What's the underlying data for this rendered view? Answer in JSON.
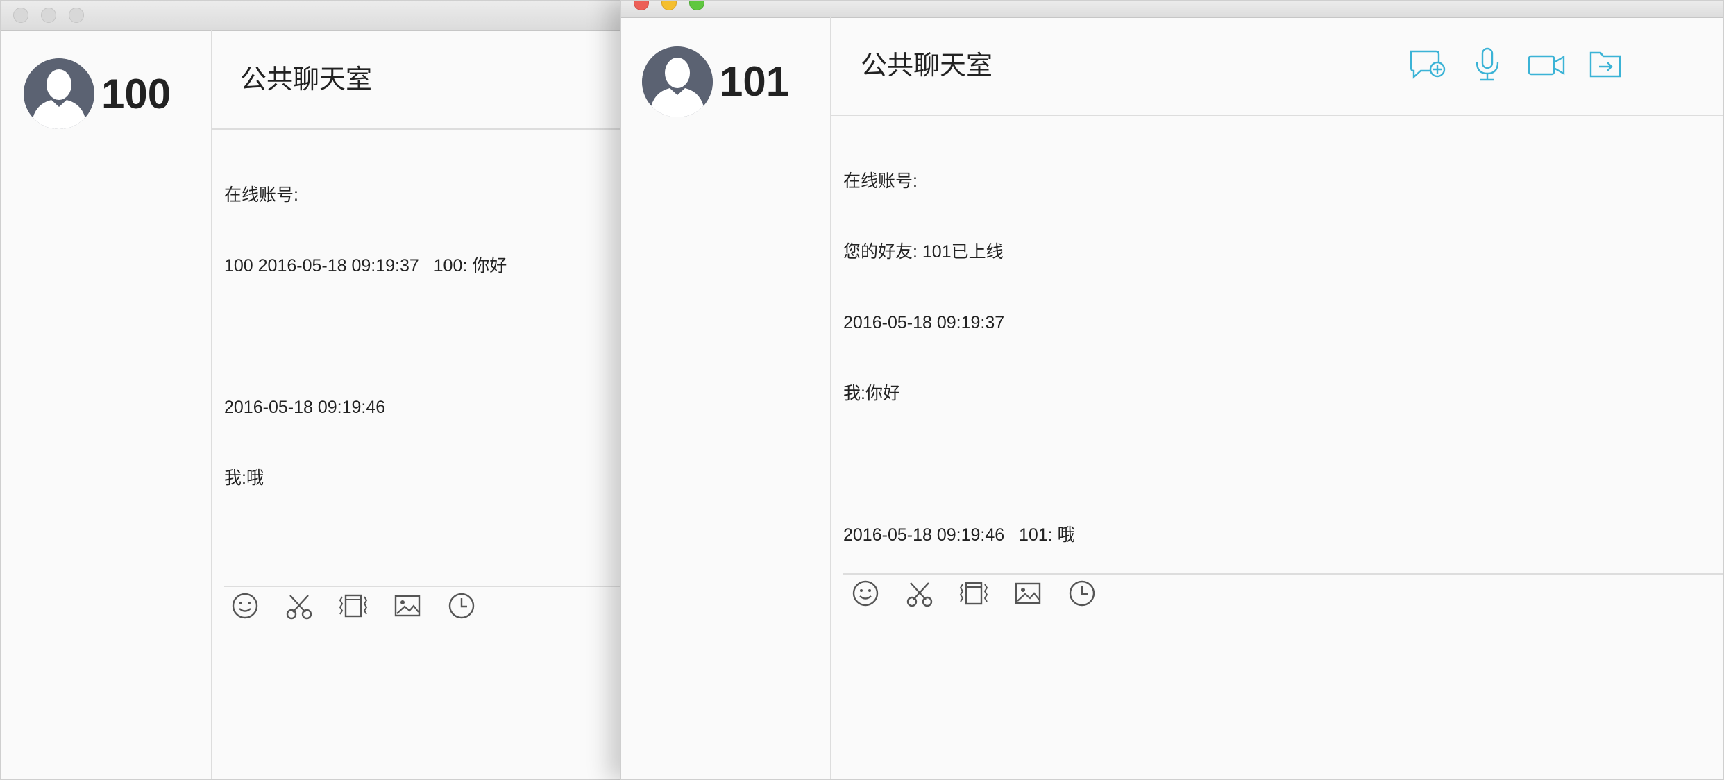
{
  "left_window": {
    "user_id": "100",
    "room_title": "公共聊天室",
    "messages": [
      "在线账号:",
      "100 2016-05-18 09:19:37   100: 你好",
      "",
      "2016-05-18 09:19:46",
      "我:哦"
    ]
  },
  "right_window": {
    "user_id": "101",
    "room_title": "公共聊天室",
    "messages": [
      "在线账号:",
      "您的好友: 101已上线",
      "2016-05-18 09:19:37",
      "我:你好",
      "",
      "2016-05-18 09:19:46   101: 哦"
    ],
    "actions": [
      "add-chat-icon",
      "microphone-icon",
      "video-camera-icon",
      "file-transfer-icon"
    ]
  },
  "toolbar_icons": [
    "emoji-icon",
    "scissors-icon",
    "shake-icon",
    "image-icon",
    "history-clock-icon"
  ],
  "colors": {
    "accent": "#3bb3d6",
    "close": "#ec5f57",
    "minimize": "#f5bf2f",
    "zoom": "#5fc73f",
    "avatar": "#5b6272",
    "toolbar_icon": "#555555"
  }
}
